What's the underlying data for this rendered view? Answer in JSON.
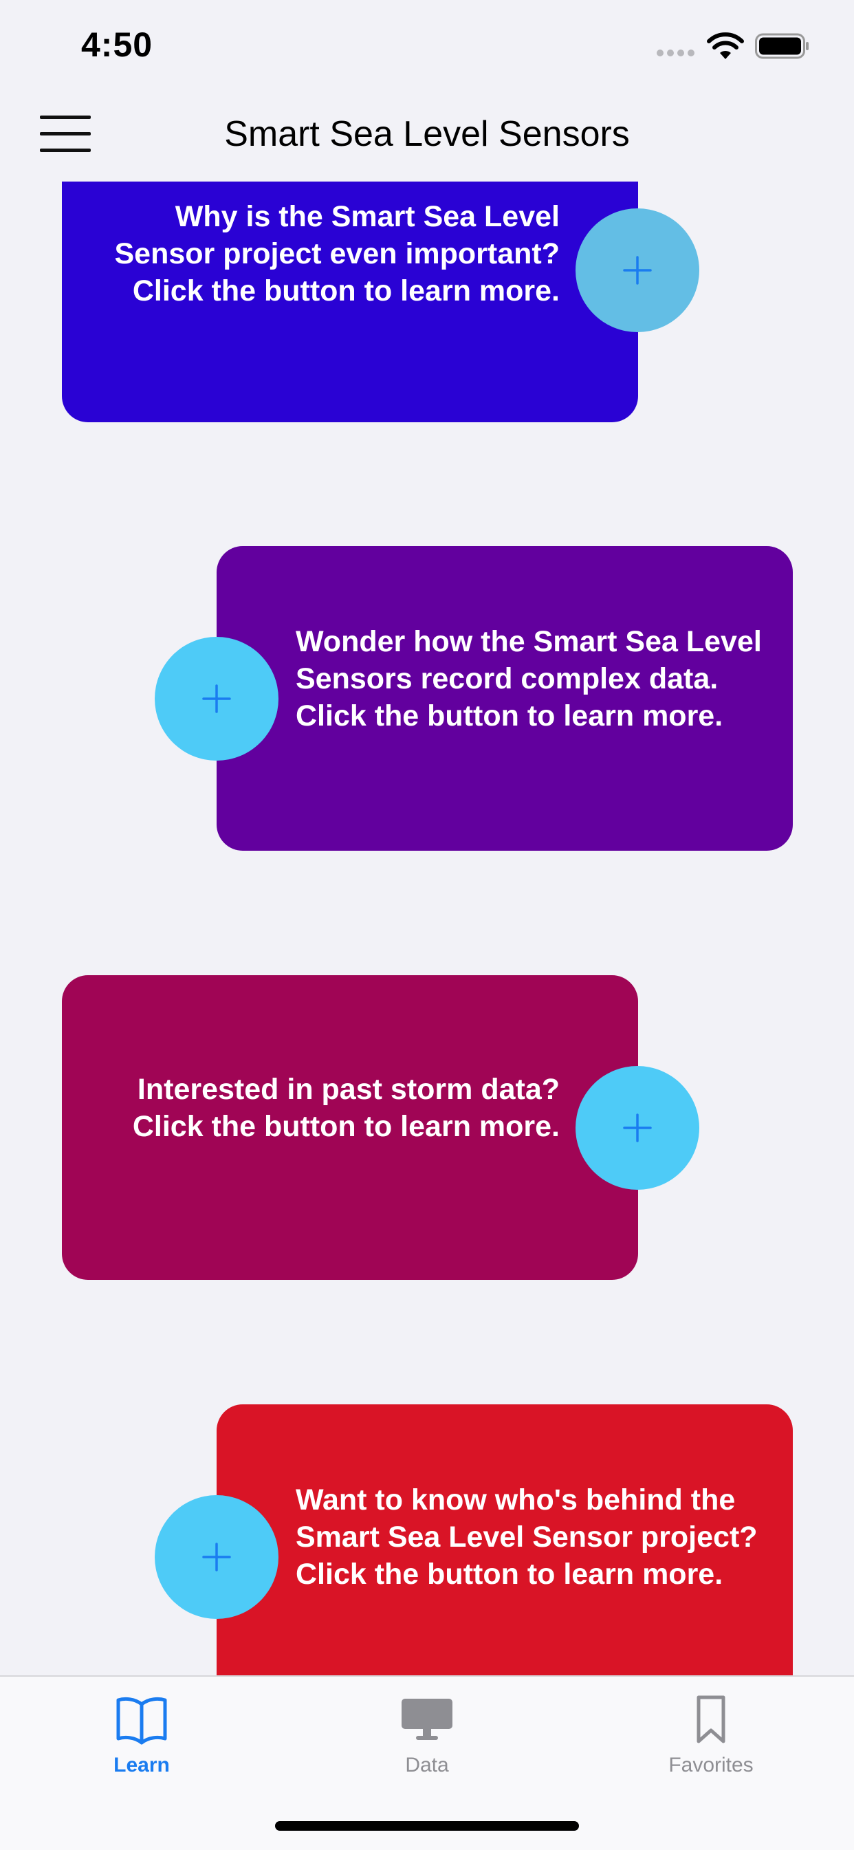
{
  "status_bar": {
    "time": "4:50"
  },
  "nav": {
    "title": "Smart Sea Level Sensors",
    "menu_icon": "hamburger-menu-icon"
  },
  "cards": [
    {
      "text": "Why is the Smart Sea Level Sensor project even important? Click the button to learn more.",
      "color": "#2a02d4",
      "button_color": "#63bee5",
      "button_icon": "plus-icon"
    },
    {
      "text": "Wonder how the Smart Sea Level Sensors record complex data. Click the button to learn more.",
      "color": "#62009e",
      "button_color": "#4ecbf7",
      "button_icon": "plus-icon"
    },
    {
      "text": "Interested in past storm data? Click the button to learn more.",
      "color": "#a00555",
      "button_color": "#4ecbf7",
      "button_icon": "plus-icon"
    },
    {
      "text": "Want to know who's behind the Smart Sea Level Sensor project? Click the button to learn more.",
      "color": "#d91426",
      "button_color": "#4ecbf7",
      "button_icon": "plus-icon"
    }
  ],
  "tabs": [
    {
      "label": "Learn",
      "icon": "book-icon",
      "active": true
    },
    {
      "label": "Data",
      "icon": "desktop-icon",
      "active": false
    },
    {
      "label": "Favorites",
      "icon": "bookmark-icon",
      "active": false
    }
  ],
  "colors": {
    "accent": "#1a7cf0",
    "background": "#f2f2f7",
    "inactive": "#8e8e93"
  }
}
